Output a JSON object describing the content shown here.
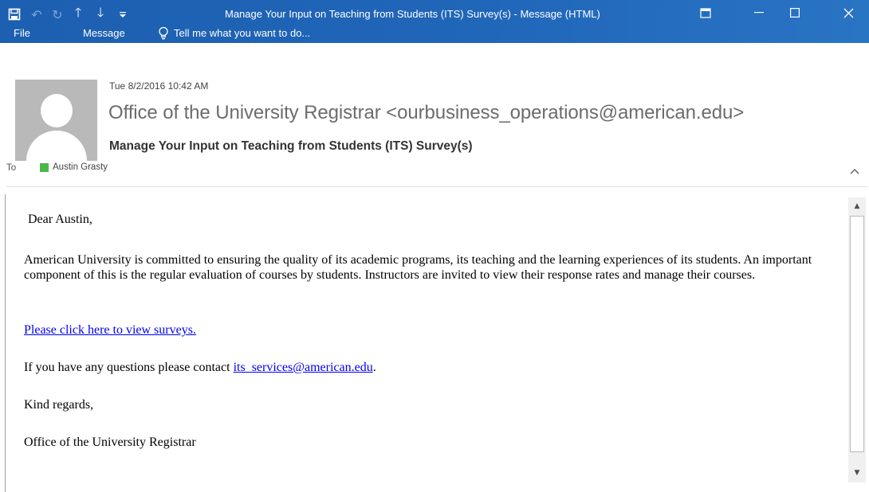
{
  "window": {
    "title": "Manage Your Input on Teaching from Students (ITS) Survey(s) - Message (HTML)",
    "accent_color": "#2066b9"
  },
  "quick_access": {
    "save_icon": "save-icon",
    "undo_icon": "undo-icon",
    "redo_icon": "redo-icon",
    "previous_icon": "up-arrow-icon",
    "next_icon": "down-arrow-icon",
    "customize_icon": "customize-icon"
  },
  "ribbon": {
    "tabs": [
      {
        "label": "File"
      },
      {
        "label": "Message"
      }
    ],
    "tell_me": "Tell me what you want to do..."
  },
  "message": {
    "date": "Tue 8/2/2016 10:42 AM",
    "sender": "Office of the University Registrar <ourbusiness_operations@american.edu>",
    "subject": "Manage Your Input on Teaching from Students (ITS) Survey(s)",
    "to_label": "To",
    "recipient": "Austin Grasty",
    "presence_color": "#4cb748"
  },
  "body": {
    "greeting": "Dear Austin,",
    "paragraph": "American University is committed to ensuring the quality of its academic programs, its teaching and the learning experiences of its students. An important component of this is the regular evaluation of courses by students. Instructors are invited to view their response rates and manage their courses.",
    "survey_link": "Please click here to view surveys.",
    "contact_prefix": "If you have any questions please contact ",
    "contact_email": "its_services@american.edu",
    "contact_suffix": ".",
    "closing": "Kind regards,",
    "signature": "Office of the University Registrar"
  }
}
